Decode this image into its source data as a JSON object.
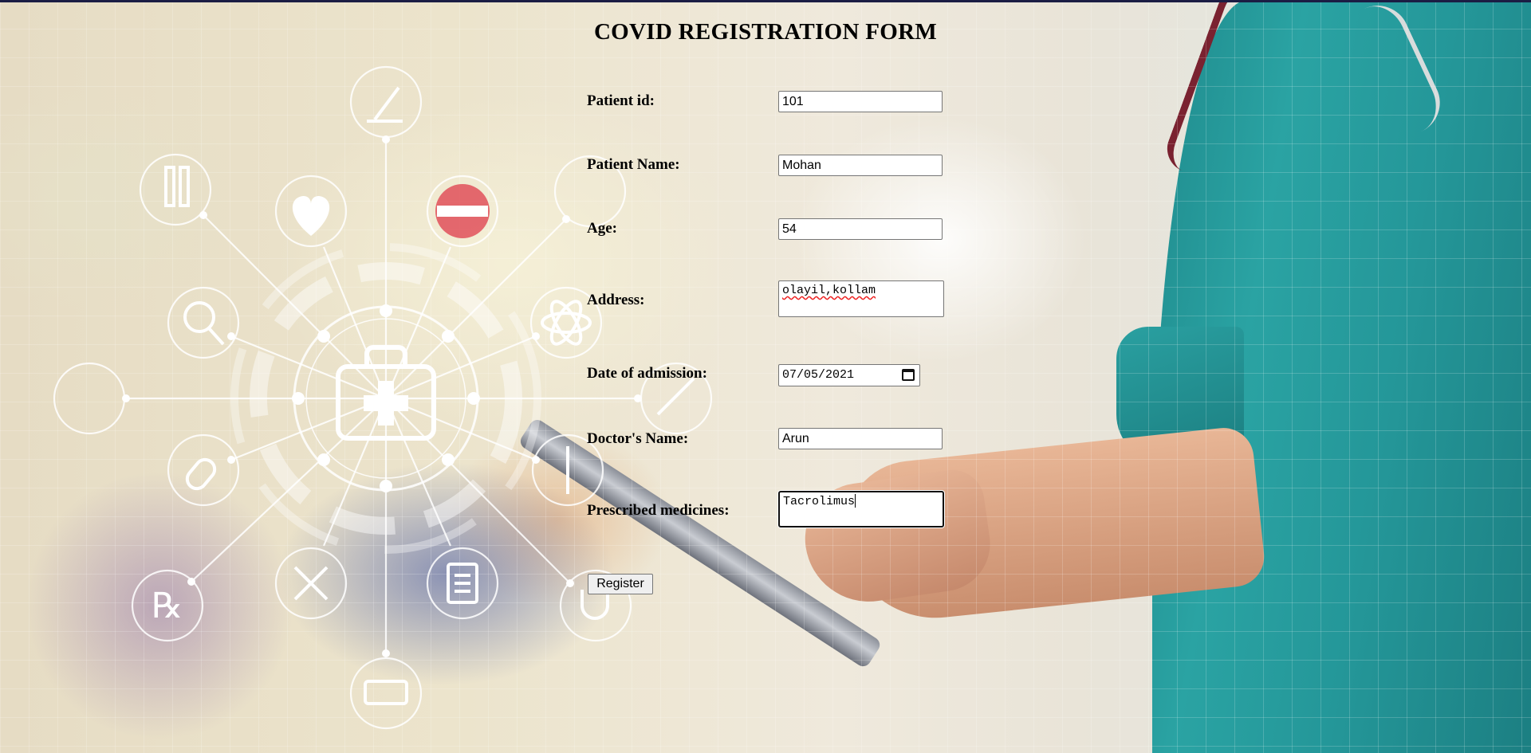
{
  "form": {
    "title": "COVID REGISTRATION FORM",
    "fields": {
      "patient_id": {
        "label": "Patient id:",
        "value": "101"
      },
      "patient_name": {
        "label": "Patient Name:",
        "value": "Mohan"
      },
      "age": {
        "label": "Age:",
        "value": "54"
      },
      "address": {
        "label": "Address:",
        "value": "olayil,kollam"
      },
      "date_of_admission": {
        "label": "Date of admission:",
        "value": "07/05/2021"
      },
      "doctor_name": {
        "label": "Doctor's Name:",
        "value": "Arun"
      },
      "prescribed_medicines": {
        "label": "Prescribed medicines:",
        "value": "Tacrolimus"
      }
    },
    "register_label": "Register"
  },
  "background": {
    "scrubs_color": "#2aa3a3",
    "hub_icons": [
      "microscope-icon",
      "flask-icon",
      "heart-plus-icon",
      "pill-capsule-icon",
      "phone-icon",
      "magnifier-icon",
      "atom-icon",
      "doctor-icon",
      "syringe-icon",
      "capsule-icon",
      "thermometer-icon",
      "prescription-icon",
      "bandage-icon",
      "clipboard-icon",
      "stethoscope-icon",
      "ambulance-icon",
      "medical-kit-icon"
    ]
  }
}
